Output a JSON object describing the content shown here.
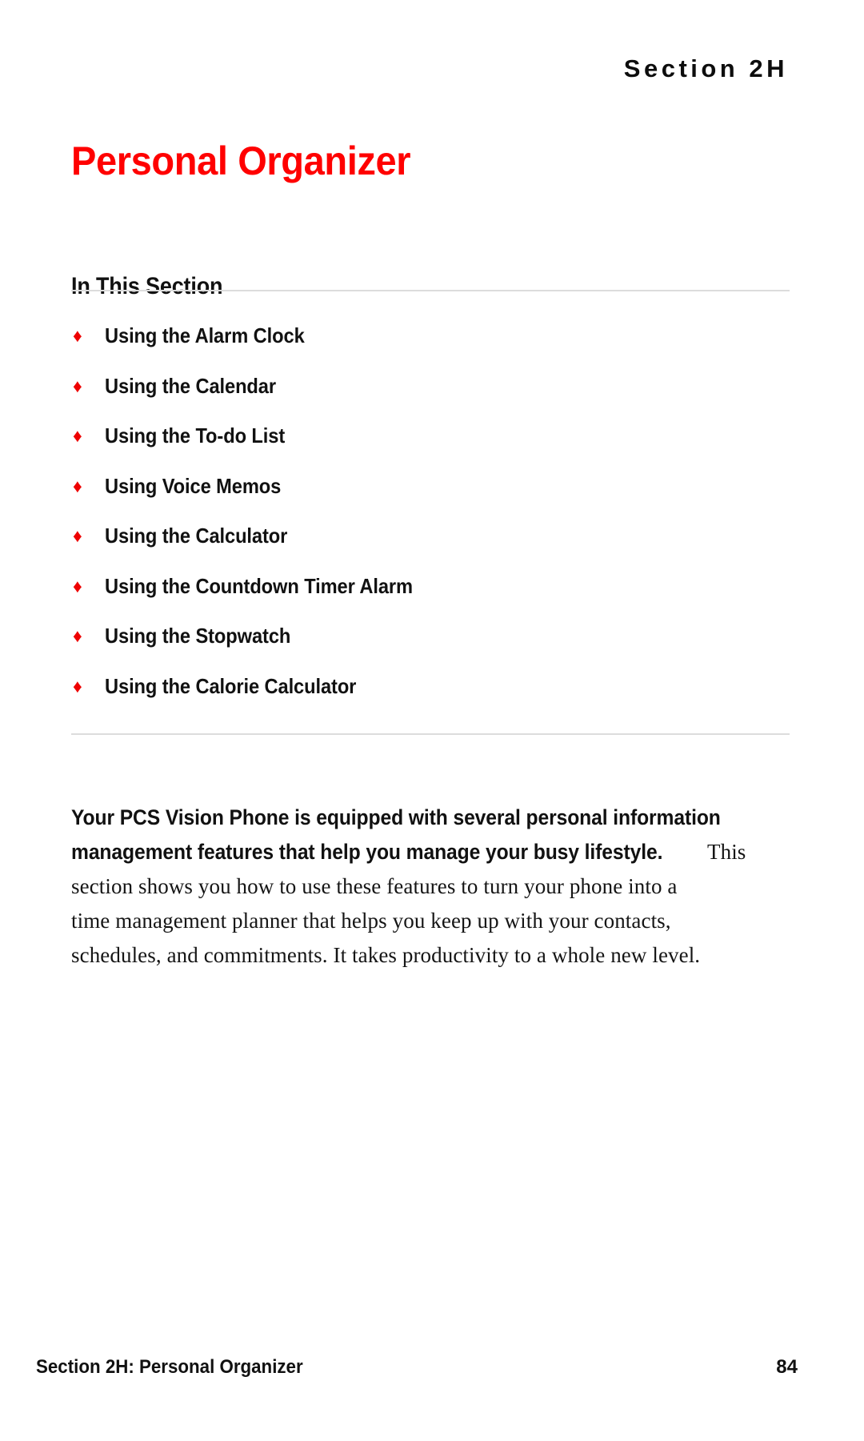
{
  "running_head": "Section 2H",
  "chapter_title": "Personal Organizer",
  "in_this_section": {
    "heading": "In This Section",
    "bullet_glyph": "♦",
    "bullet_color": "#ee0000",
    "items": [
      {
        "label": "Using the Alarm Clock"
      },
      {
        "label": "Using the Calendar"
      },
      {
        "label": "Using the To-do List"
      },
      {
        "label": "Using Voice Memos"
      },
      {
        "label": "Using the Calculator"
      },
      {
        "label": "Using the Countdown Timer Alarm"
      },
      {
        "label": "Using the Stopwatch"
      },
      {
        "label": "Using the Calorie Calculator"
      }
    ]
  },
  "intro": {
    "lead_line_1": "Your PCS Vision Phone is equipped with several personal information",
    "lead_line_2": "management features that help you manage your busy lifestyle.",
    "body_line_2_tail": " This",
    "body_line_3": "section shows you how to use these features to turn your phone into a",
    "body_line_4": "time management planner that helps you keep up with your contacts,",
    "body_line_5": "schedules, and commitments. It takes productivity to a whole new level."
  },
  "footer": {
    "left": "Section 2H: Personal Organizer",
    "page_number": "84"
  },
  "colors": {
    "title_red": "#ff0000",
    "bullet_red": "#ee0000",
    "text_black": "#111111",
    "rule_gray": "#dcdcdc",
    "page_background": "#ffffff"
  }
}
